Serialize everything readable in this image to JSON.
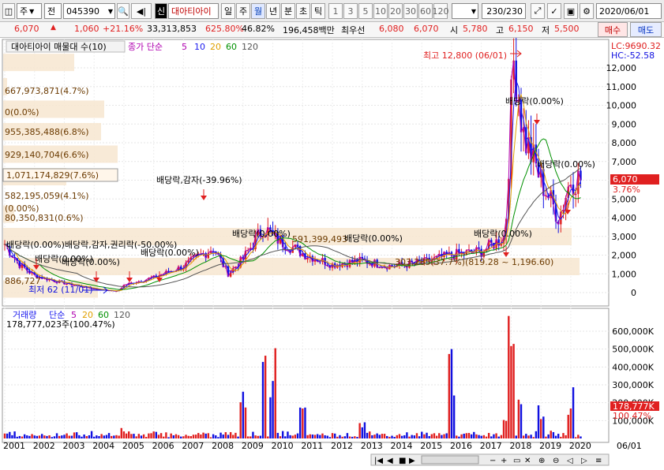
{
  "toolbar": {
    "mode": "주",
    "mode2": "전",
    "code": "045390",
    "search_icon": "search-icon",
    "badge": "신",
    "name": "대아티아이",
    "periods": [
      "일",
      "주",
      "월",
      "년",
      "분",
      "초",
      "틱"
    ],
    "selected_period": "월",
    "intervals": [
      "1",
      "3",
      "5",
      "10",
      "20",
      "30",
      "60",
      "120"
    ],
    "count": "230/230",
    "date": "2020/06/01"
  },
  "price": {
    "last": "6,070",
    "change": "1,060",
    "pct": "+21.16%",
    "volume": "33,313,853",
    "vol_ratio": "625.80%",
    "turnover": "46.82%",
    "amount": "196,458백만",
    "best_label": "최우선",
    "ask": "6,080",
    "bid": "6,070",
    "open_label": "시",
    "open": "5,780",
    "high_label": "고",
    "high": "6,150",
    "low_label": "저",
    "low": "5,500",
    "buy": "매수",
    "sell": "매도"
  },
  "colors": {
    "up": "#e02020",
    "down": "#1010e0",
    "ma5": "#b000b0",
    "ma10": "#1a1aee",
    "ma20": "#e0a000",
    "ma60": "#009000",
    "ma120": "#555555"
  },
  "upper": {
    "legend_title": "대아티아이 매물대 수(10)",
    "legend_ma_label": "종가 단순",
    "ma_periods": [
      "5",
      "10",
      "20",
      "60",
      "120"
    ],
    "lc": "LC:9690.32",
    "hc": "HC:-52.58",
    "cur_price": "6,070",
    "cur_pct": "3.76%",
    "y_ticks": [
      "12,000",
      "11,000",
      "10,000",
      "9,000",
      "8,000",
      "7,000",
      "6,000",
      "5,000",
      "4,000",
      "3,000",
      "2,000",
      "1,000",
      "0"
    ],
    "high_note": "최고 12,800 (06/01)",
    "low_note": "최저 62 (11/01)",
    "vp_labels": [
      "667,973,871(4.7%)",
      "0(0.0%)",
      "955,385,488(6.8%)",
      "929,140,704(6.6%)",
      "1,071,174,829(7.6%)",
      "582,195,059(4.1%)",
      "(0.00%)",
      "80,350,831(0.6%)"
    ],
    "vp_bottom": "886,727",
    "vp_mid": "591,399,493",
    "vp_range": "303,285(37.7%)(819.28 ~ 1,196.60)",
    "dividend_notes": [
      "배당락,감자(-39.96%)",
      "배당락(0.00%)",
      "배당락(0.00%)",
      "배당락(0.00%)",
      "배당락(0.00%)",
      "배당락(0.00%)배당락,감자,권리락(-50.00%)",
      "배당락(0.00%)",
      "배당락(0.00%)",
      "배당락(0.00%)",
      "배당락(0.00%)"
    ]
  },
  "lower": {
    "legend_title": "거래량",
    "legend_ma_label": "단순",
    "ma_periods": [
      "5",
      "20",
      "60",
      "120"
    ],
    "current": "178,777,023주(100.47%)",
    "cur_val": "178,777K",
    "cur_pct": "100.47%",
    "y_ticks": [
      "600,000K",
      "500,000K",
      "400,000K",
      "300,000K",
      "200,000K",
      "100,000K"
    ]
  },
  "x_axis": [
    "2001",
    "2002",
    "2003",
    "2004",
    "2005",
    "2006",
    "2007",
    "2008",
    "2009",
    "2010",
    "2011",
    "2012",
    "2013",
    "2014",
    "2015",
    "2016",
    "2017",
    "2018",
    "2019",
    "2020"
  ],
  "x_axis_right": "06/01",
  "chart_data": {
    "type": "candlestick",
    "x_unit": "year",
    "price_series": [
      {
        "year": 2001,
        "close": 2600
      },
      {
        "year": 2001.5,
        "close": 1500
      },
      {
        "year": 2002,
        "close": 900
      },
      {
        "year": 2003,
        "close": 500
      },
      {
        "year": 2004,
        "close": 200
      },
      {
        "year": 2004.8,
        "close": 62
      },
      {
        "year": 2005,
        "close": 400
      },
      {
        "year": 2006,
        "close": 800
      },
      {
        "year": 2007,
        "close": 1400
      },
      {
        "year": 2008,
        "close": 2400
      },
      {
        "year": 2008.5,
        "close": 1000
      },
      {
        "year": 2009,
        "close": 1800
      },
      {
        "year": 2009.7,
        "close": 3500
      },
      {
        "year": 2010,
        "close": 3000
      },
      {
        "year": 2011,
        "close": 2100
      },
      {
        "year": 2012,
        "close": 1500
      },
      {
        "year": 2013,
        "close": 1700
      },
      {
        "year": 2014,
        "close": 1400
      },
      {
        "year": 2015,
        "close": 1600
      },
      {
        "year": 2016,
        "close": 2000
      },
      {
        "year": 2017,
        "close": 2200
      },
      {
        "year": 2017.8,
        "close": 3000
      },
      {
        "year": 2018,
        "close": 10000
      },
      {
        "year": 2018.1,
        "close": 12800
      },
      {
        "year": 2018.4,
        "close": 8500
      },
      {
        "year": 2019,
        "close": 6000
      },
      {
        "year": 2019.6,
        "close": 4000
      },
      {
        "year": 2020,
        "close": 6070
      }
    ],
    "ylim": [
      0,
      13000
    ],
    "volume_k": [
      {
        "year": 2001,
        "v": 40000
      },
      {
        "year": 2003,
        "v": 30000
      },
      {
        "year": 2005,
        "v": 60000
      },
      {
        "year": 2009,
        "v": 280000
      },
      {
        "year": 2009.7,
        "v": 480000
      },
      {
        "year": 2010,
        "v": 570000
      },
      {
        "year": 2011,
        "v": 200000
      },
      {
        "year": 2013,
        "v": 120000
      },
      {
        "year": 2016,
        "v": 570000
      },
      {
        "year": 2017.8,
        "v": 200000
      },
      {
        "year": 2018,
        "v": 660000
      },
      {
        "year": 2018.3,
        "v": 350000
      },
      {
        "year": 2019,
        "v": 250000
      },
      {
        "year": 2020,
        "v": 330000
      }
    ],
    "volume_ylim_k": [
      0,
      650000
    ]
  }
}
